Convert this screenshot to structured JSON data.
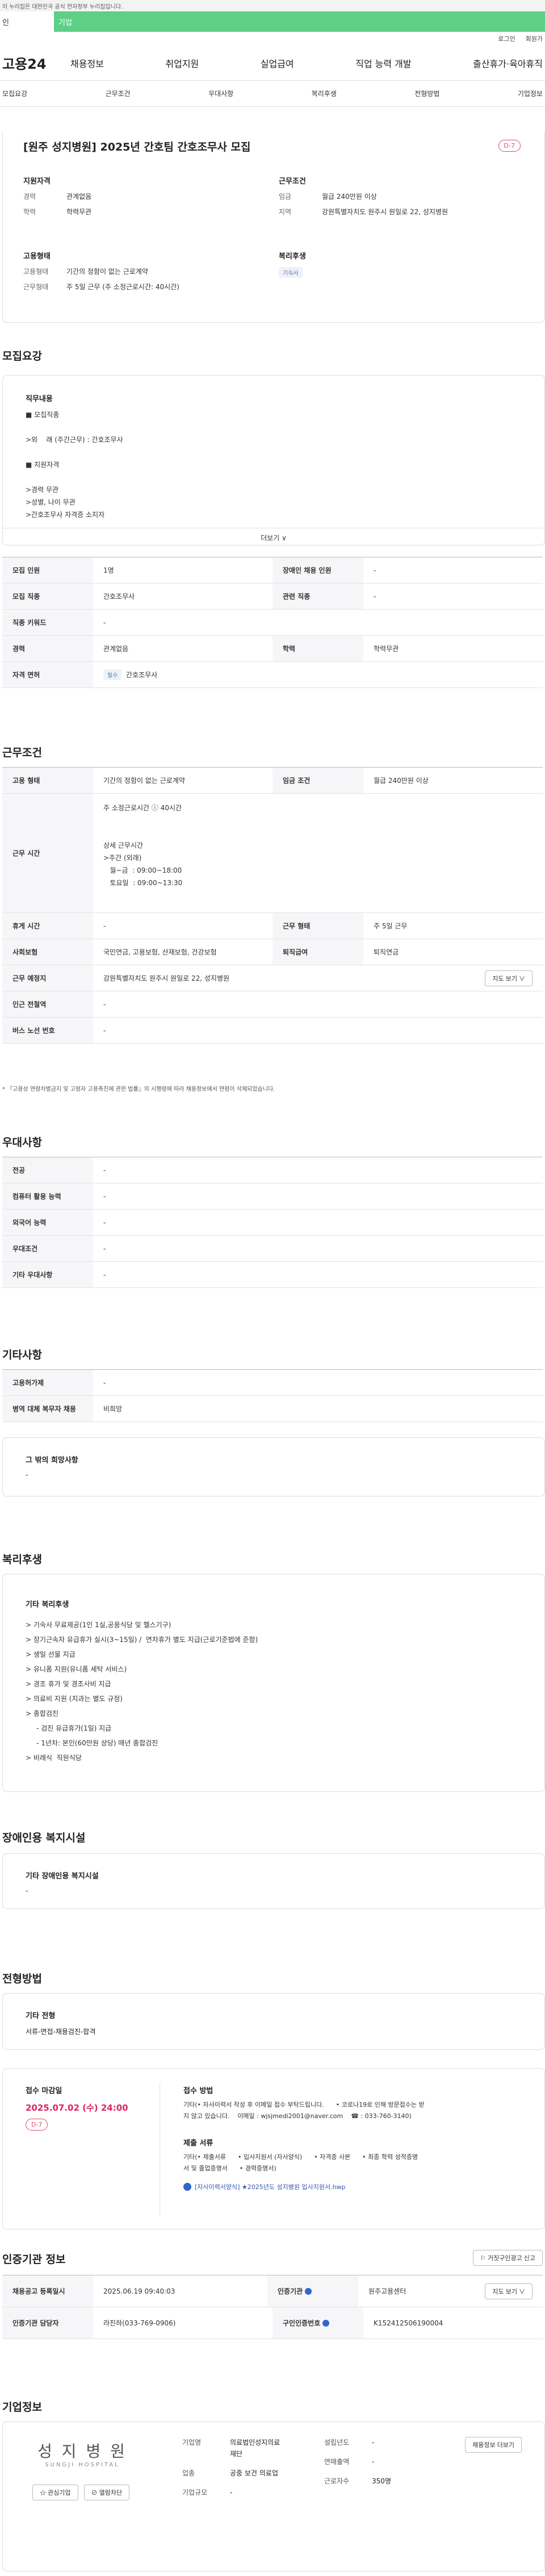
{
  "top_notice": "이 누리집은 대한민국 공식 전자정부 누리집입니다.",
  "greenbar": {
    "left": "인",
    "right": "기업"
  },
  "util": {
    "login": "로그인",
    "signup": "회원가"
  },
  "logo": "고용24",
  "gnb": [
    "채용정보",
    "취업지원",
    "실업급여",
    "직업 능력 개발",
    "출산휴가·육아휴직"
  ],
  "tabs": [
    "모집요강",
    "근무조건",
    "우대사항",
    "복리후생",
    "전형방법",
    "기업정보"
  ],
  "header": {
    "title": "[원주 성지병원] 2025년 간호팀 간호조무사 모집",
    "dday": "D-7",
    "qual_title": "지원자격",
    "qual": [
      {
        "k": "경력",
        "v": "관계없음"
      },
      {
        "k": "학력",
        "v": "학력무관"
      }
    ],
    "cond_title": "근무조건",
    "cond": [
      {
        "k": "임금",
        "v": "월급 240만원 이상"
      },
      {
        "k": "지역",
        "v": "강원특별자치도 원주시 원일로 22, 성지병원"
      }
    ],
    "emp_title": "고용형태",
    "emp": [
      {
        "k": "고용형태",
        "v": "기간의 정함이 없는 근로계약"
      },
      {
        "k": "근무형태",
        "v": "주 5일 근무 (주 소정근로시간: 40시간)"
      }
    ],
    "welfare_title": "복리후생",
    "welfare_tag": "기숙사"
  },
  "recruit": {
    "title": "모집요강",
    "duty_title": "직무내용",
    "duty_text": "■ 모집직종\n\n>외    래 (주간근무) : 간호조무사\n\n■ 지원자격\n\n>경력 무관\n>성별, 나이 무관\n>간호조무사 자격증 소지자",
    "more": "더보기 ∨",
    "rows": [
      {
        "k1": "모집 인원",
        "v1": "1명",
        "k2": "장애인 채용 인원",
        "v2": "-"
      },
      {
        "k1": "모집 직종",
        "v1": "간호조무사",
        "k2": "관련 직종",
        "v2": "-"
      },
      {
        "k1": "직종 키워드",
        "v1": "-"
      },
      {
        "k1": "경력",
        "v1": "관계없음",
        "k2": "학력",
        "v2": "학력무관"
      },
      {
        "k1": "자격 면허",
        "tag": "필수",
        "v1": "간호조무사"
      }
    ]
  },
  "work": {
    "title": "근무조건",
    "employ_k": "고용 형태",
    "employ_v": "기간의 정함이 없는 근로계약",
    "wage_k": "임금 조건",
    "wage_v": "월급 240만원 이상",
    "time_k": "근무 시간",
    "time_text": "주 소정근로시간 ⓘ 40시간\n\n\n상세 근무시간\n>주간 (외래)\n   월~금  : 09:00~18:00\n   토요일  : 09:00~13:30",
    "rest_k": "휴게 시간",
    "rest_v": "-",
    "type_k": "근무 형태",
    "type_v": "주 5일 근무",
    "ins_k": "사회보험",
    "ins_v": "국민연금, 고용보험, 산재보험, 건강보험",
    "ret_k": "퇴직급여",
    "ret_v": "퇴직연금",
    "place_k": "근무 예정지",
    "place_v": "강원특별자치도 원주시 원일로 22, 성지병원",
    "map_btn": "지도 보기 ∨",
    "sub_k": "인근 전철역",
    "sub_v": "-",
    "bus_k": "버스 노선 번호",
    "bus_v": "-",
    "note": "* 『고용상 연령차별금지 및 고령자 고용촉진에 관한 법률』의 시행령에 따라 채용정보에서 연령이 삭제되었습니다."
  },
  "pref": {
    "title": "우대사항",
    "rows": [
      {
        "k": "전공",
        "v": "-"
      },
      {
        "k": "컴퓨터 활용 능력",
        "v": "-"
      },
      {
        "k": "외국어 능력",
        "v": "-"
      },
      {
        "k": "우대조건",
        "v": "-"
      },
      {
        "k": "기타 우대사항",
        "v": "-"
      }
    ]
  },
  "etc": {
    "title": "기타사항",
    "rows": [
      {
        "k": "고용허가제",
        "v": "-"
      },
      {
        "k": "병역 대체 복무자 채용",
        "v": "비희망"
      }
    ],
    "other_title": "그 밖의 희망사항",
    "other_v": "-"
  },
  "welfare": {
    "title": "복리후생",
    "sub": "기타 복리후생",
    "text": "> 기숙사 무료제공(1인 1실,공용식당 및 헬스기구)\n> 장기근속자 유급휴가 실시(3~15일) /  연차휴가 별도 지급(근로기준법에 준함)\n> 생일 선물 지급\n> 유니폼 지원(유니폼 세탁 서비스)\n> 경조 휴가 및 경조사비 지급\n> 의료비 지원 (치과는 별도 규정)\n> 종합검진\n     - 검진 유급휴가(1일) 지급\n     - 1년차: 본인(60만원 상당) 매년 종합검진\n> 비례식  직원식당"
  },
  "disabled": {
    "title": "장애인용 복지시설",
    "sub": "기타 장애인용 복지시설",
    "v": "-"
  },
  "select": {
    "title": "전형방법",
    "sub": "기타 전형",
    "v": "서류-면접-채용검진-합격"
  },
  "apply": {
    "deadline_title": "접수 마감일",
    "deadline": "2025.07.02 (수) 24:00",
    "dday": "D-7",
    "method_title": "접수 방법",
    "method_text": "기타(• 자사이력서 작성 후 이메일 접수 부탁드립니다.      • 코로나19로 인해 방문접수는 받\n지 않고 있습니다.    이메일 : wjsjmedi2001@naver.com    ☎ : 033-760-3140)",
    "docs_title": "제출 서류",
    "docs_text": "기타(• 제출서류      • 입사지원서 (자사양식)      • 자격증 사본      • 최종 학력 성적증명\n서 및 졸업증명서      • 경력증명서)",
    "file": "[자사이력서양식] ★2025년도 성지병원 입사지원서.hwp"
  },
  "agency": {
    "title": "인증기관 정보",
    "report_btn": "거짓구인광고 신고",
    "reg_k": "채용공고 등록일시",
    "reg_v": "2025.06.19 09:40:03",
    "org_k": "인증기관",
    "org_v": "원주고용센터",
    "map_btn": "지도 보기 ∨",
    "mgr_k": "인증기관 담당자",
    "mgr_v": "라진하(033-769-0906)",
    "id_k": "구인인증번호",
    "id_v": "K152412506190004"
  },
  "company": {
    "title": "기업정보",
    "logo_ko": "성 지 병 원",
    "logo_en": "SUNGJI HOSPITAL",
    "interest_btn": "☆ 관심기업",
    "block_btn": "⊘ 열람차단",
    "info": [
      {
        "k": "기업명",
        "v": "의료법인성지의료\n재단"
      },
      {
        "k": "업종",
        "v": "공중 보건 의료업"
      },
      {
        "k": "기업규모",
        "v": "-"
      }
    ],
    "info2": [
      {
        "k": "설립년도",
        "v": "-"
      },
      {
        "k": "연매출액",
        "v": "-"
      },
      {
        "k": "근로자수",
        "v": "350명"
      }
    ],
    "jobs_btn": "채용정보 더보기"
  }
}
